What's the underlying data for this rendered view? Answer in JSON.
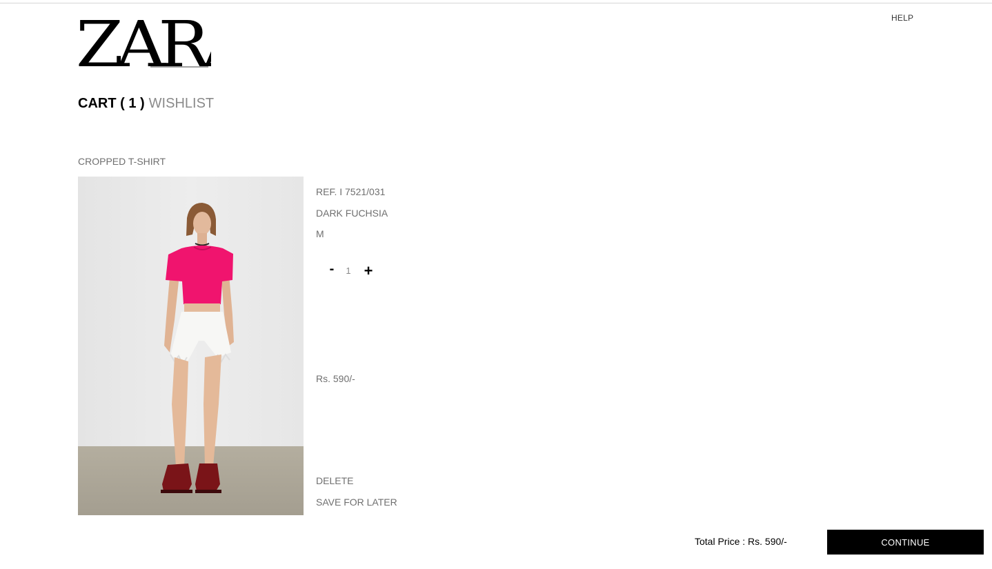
{
  "brand": {
    "logo_text": "ZARA"
  },
  "header": {
    "help_label": "HELP"
  },
  "tabs": {
    "cart_label": "CART ( 1 )",
    "wishlist_label": "WISHLIST"
  },
  "cart": {
    "items": [
      {
        "name": "CROPPED T-SHIRT",
        "ref": "REF. I 7521/031",
        "color": "DARK FUCHSIA",
        "size": "M",
        "quantity": "1",
        "decrease_label": "-",
        "increase_label": "+",
        "price": "Rs. 590/-",
        "delete_label": "DELETE",
        "save_for_later_label": "SAVE FOR LATER"
      }
    ]
  },
  "footer": {
    "total_text": "Total Price : Rs. 590/-",
    "continue_label": "CONTINUE"
  },
  "colors": {
    "accent": "#000000",
    "muted_text": "#6f6f6f",
    "product_color": "#f0146e"
  },
  "icons": [
    "zara-logo",
    "minus-icon",
    "plus-icon"
  ]
}
